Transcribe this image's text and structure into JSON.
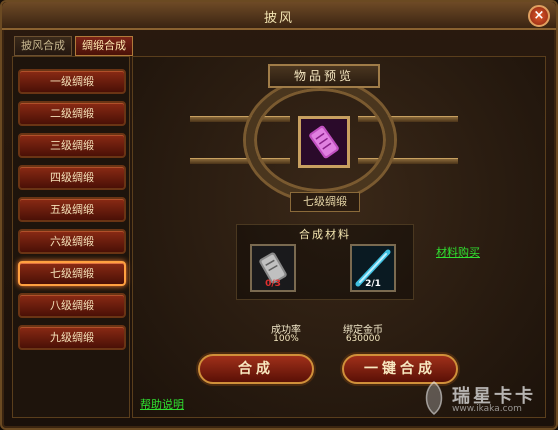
{
  "window": {
    "title": "披风",
    "close_label": "×"
  },
  "tabs": [
    {
      "label": "披风合成",
      "active": false
    },
    {
      "label": "绸缎合成",
      "active": true
    }
  ],
  "levels": [
    {
      "label": "一级绸缎"
    },
    {
      "label": "二级绸缎"
    },
    {
      "label": "三级绸缎"
    },
    {
      "label": "四级绸缎"
    },
    {
      "label": "五级绸缎"
    },
    {
      "label": "六级绸缎"
    },
    {
      "label": "七级绸缎",
      "selected": true
    },
    {
      "label": "八级绸缎"
    },
    {
      "label": "九级绸缎"
    }
  ],
  "preview": {
    "title": "物品预览",
    "item_name": "七级绸缎"
  },
  "materials": {
    "title": "合成材料",
    "slots": [
      {
        "count": "0/3",
        "count_color": "#e03030"
      },
      {
        "count": "2/1",
        "count_color": "#ffffff"
      }
    ],
    "buy_link": "材料购买"
  },
  "stats": {
    "success_label": "成功率",
    "success_value": "100%",
    "gold_label": "绑定金币",
    "gold_value": "630000"
  },
  "buttons": {
    "synthesize": "合成",
    "one_click": "一键合成"
  },
  "help_link": "帮助说明",
  "watermark": {
    "brand": "瑞星卡卡",
    "url": "www.ikaka.com"
  },
  "colors": {
    "accent": "#d0903a",
    "link": "#30e030"
  }
}
